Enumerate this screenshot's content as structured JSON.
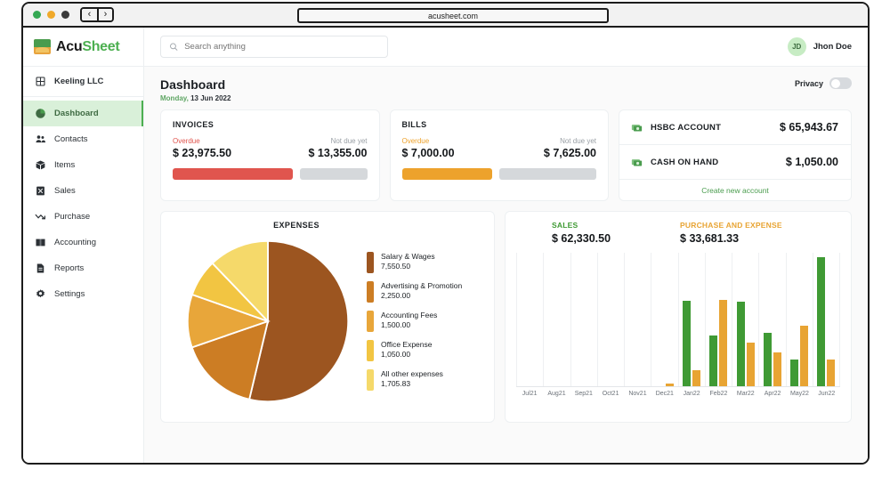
{
  "browser": {
    "url": "acusheet.com",
    "back_label": "‹",
    "forward_label": "›"
  },
  "brand": {
    "name_first": "Acu",
    "name_second": "Sheet"
  },
  "sidebar": {
    "org": "Keeling LLC",
    "items": [
      {
        "label": "Dashboard",
        "icon": "pie-chart-icon",
        "active": true
      },
      {
        "label": "Contacts",
        "icon": "contacts-icon",
        "active": false
      },
      {
        "label": "Items",
        "icon": "box-icon",
        "active": false
      },
      {
        "label": "Sales",
        "icon": "sales-icon",
        "active": false
      },
      {
        "label": "Purchase",
        "icon": "purchase-trend-icon",
        "active": false
      },
      {
        "label": "Accounting",
        "icon": "book-icon",
        "active": false
      },
      {
        "label": "Reports",
        "icon": "report-icon",
        "active": false
      },
      {
        "label": "Settings",
        "icon": "gear-icon",
        "active": false
      }
    ]
  },
  "topbar": {
    "search_placeholder": "Search anything",
    "search_value": "",
    "user_initials": "JD",
    "user_name": "Jhon Doe"
  },
  "page": {
    "title": "Dashboard",
    "date_weekday": "Monday,",
    "date_rest": "13 Jun 2022",
    "privacy_label": "Privacy",
    "privacy_on": false
  },
  "kpi_cards": [
    {
      "title": "INVOICES",
      "overdue_label": "Overdue",
      "overdue_value": "$ 23,975.50",
      "notdue_label": "Not due yet",
      "notdue_value": "$ 13,355.00",
      "accent": "#e0554e",
      "fill_percent": 64
    },
    {
      "title": "BILLS",
      "overdue_label": "Overdue",
      "overdue_value": "$ 7,000.00",
      "notdue_label": "Not due yet",
      "notdue_value": "$ 7,625.00",
      "accent": "#eda22c",
      "fill_percent": 48
    }
  ],
  "accounts": {
    "rows": [
      {
        "name": "HSBC ACCOUNT",
        "amount": "$ 65,943.67",
        "icon": "money-icon"
      },
      {
        "name": "CASH ON HAND",
        "amount": "$ 1,050.00",
        "icon": "money-icon"
      }
    ],
    "create_label": "Create new account"
  },
  "chart_data": [
    {
      "type": "pie",
      "title": "EXPENSES",
      "labels": [
        "Salary & Wages",
        "Advertising & Promotion",
        "Accounting Fees",
        "Office Expense",
        "All other expenses"
      ],
      "values": [
        7550.5,
        2250.0,
        1500.0,
        1050.0,
        1705.83
      ],
      "value_labels": [
        "7,550.50",
        "2,250.00",
        "1,500.00",
        "1,050.00",
        "1,705.83"
      ],
      "colors": [
        "#9c5520",
        "#cc7d24",
        "#e8a63a",
        "#f2c542",
        "#f5d96a"
      ],
      "legend": "right",
      "total": 14056.33
    },
    {
      "type": "bar",
      "title": "",
      "series": [
        {
          "name": "SALES",
          "total_label": "$ 62,330.50",
          "color": "#3f9a34",
          "values": [
            0,
            0,
            0,
            0,
            0,
            0,
            10900,
            6500,
            10750,
            6850,
            3400,
            16400
          ]
        },
        {
          "name": "PURCHASE AND EXPENSE",
          "total_label": "$ 33,681.33",
          "color": "#e8a433",
          "values": [
            0,
            0,
            0,
            0,
            0,
            350,
            2000,
            11000,
            5550,
            4350,
            7700,
            3400
          ]
        }
      ],
      "categories": [
        "Jul21",
        "Aug21",
        "Sep21",
        "Oct21",
        "Nov21",
        "Dec21",
        "Jan22",
        "Feb22",
        "Mar22",
        "Apr22",
        "May22",
        "Jun22"
      ],
      "xlabel": "",
      "ylabel": "",
      "ylim": [
        0,
        17000
      ],
      "grid": "vertical",
      "legend": "top"
    }
  ]
}
